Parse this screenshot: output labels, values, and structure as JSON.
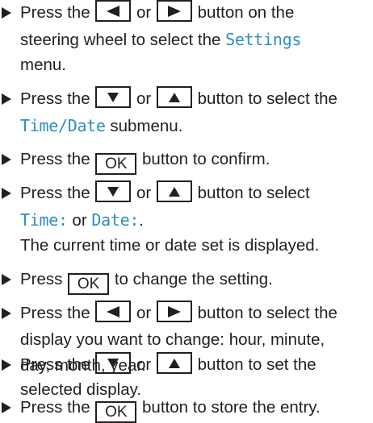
{
  "colors": {
    "text": "#231f20",
    "display_term": "#2a8fc2",
    "background": "#ffffff"
  },
  "icons": {
    "bullet": "right-pointing-triangle",
    "left_key": "left-arrow-key",
    "right_key": "right-arrow-key",
    "down_key": "down-arrow-key",
    "up_key": "up-arrow-key"
  },
  "keys": {
    "ok": "OK"
  },
  "steps": [
    {
      "l1": {
        "a": "Press the",
        "b": "or",
        "c": "button on the"
      },
      "l2": {
        "a": "steering wheel to select the",
        "term": "Settings"
      },
      "l3": {
        "a": "menu."
      }
    },
    {
      "l1": {
        "a": "Press the",
        "b": "or",
        "c": "button to select the"
      },
      "l2": {
        "term": "Time/Date",
        "a": "submenu."
      }
    },
    {
      "l1": {
        "a": "Press the",
        "c": "button to confirm."
      }
    },
    {
      "l1": {
        "a": "Press the",
        "b": "or",
        "c": "button to select"
      },
      "l2": {
        "term1": "Time:",
        "a": "or",
        "term2": "Date:",
        "dot": "."
      },
      "l3": {
        "a": "The current time or date set is displayed."
      }
    },
    {
      "l1": {
        "a": "Press",
        "c": "to change the setting."
      }
    },
    {
      "l1": {
        "a": "Press the",
        "b": "or",
        "c": "button to select the"
      },
      "l2": {
        "a": "display you want to change: hour, minute,"
      },
      "l3": {
        "a": "day, month, year."
      }
    },
    {
      "l1": {
        "a": "Press the",
        "b": "or",
        "c": "button to set the"
      },
      "l2": {
        "a": "selected display."
      }
    },
    {
      "l1": {
        "a": "Press the",
        "c": "button to store the entry."
      }
    }
  ]
}
